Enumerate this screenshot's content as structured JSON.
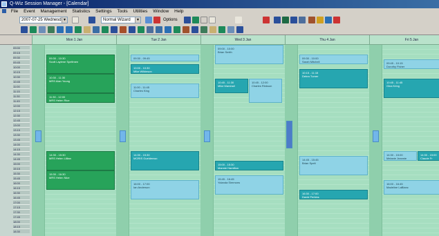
{
  "window": {
    "title": "Q-Wiz Session Manager - [Calendar]"
  },
  "menu": {
    "items": [
      "File",
      "Event",
      "Management",
      "Statistics",
      "Settings",
      "Tools",
      "Utilities",
      "Window",
      "Help"
    ]
  },
  "toolbar": {
    "date_value": "2007-07-25 Wednesday",
    "view_value": "Normal Wizard",
    "options_label": "Options"
  },
  "calendar": {
    "days": [
      {
        "label": "Mon 1 Jan"
      },
      {
        "label": "Tue 2 Jan"
      },
      {
        "label": "Wed 3 Jan"
      },
      {
        "label": "Thu 4 Jan"
      },
      {
        "label": "Fri 5 Jan"
      }
    ],
    "times": [
      "09:00",
      "09:15",
      "09:30",
      "09:45",
      "10:00",
      "10:15",
      "10:30",
      "10:45",
      "11:00",
      "11:15",
      "11:30",
      "11:45",
      "12:00",
      "12:15",
      "12:30",
      "12:45",
      "13:00",
      "13:15",
      "13:30",
      "13:45",
      "14:00",
      "14:15",
      "14:30",
      "14:45",
      "15:00",
      "15:15",
      "15:30",
      "15:45",
      "16:00",
      "16:15",
      "16:30",
      "16:45",
      "17:00",
      "17:15",
      "17:30",
      "17:45",
      "18:00",
      "18:15",
      "18:30"
    ],
    "appointments": [
      {
        "day": 0,
        "time": "09:30 - 10:30",
        "name": "Scott Laylene Speltmen",
        "color": "green"
      },
      {
        "day": 0,
        "time": "10:30 - 11:30",
        "name": "MRS Alan Young",
        "color": "green"
      },
      {
        "day": 0,
        "time": "11:30 - 12:00",
        "name": "MRS Helen Rice",
        "color": "green"
      },
      {
        "day": 0,
        "time": "14:30 - 15:30",
        "name": "MRS Helen Lillian",
        "color": "green"
      },
      {
        "day": 0,
        "time": "15:30 - 16:30",
        "name": "MRS Helen Nice",
        "color": "green"
      },
      {
        "day": 1,
        "time": "09:30 - 09:45",
        "name": "Daniel Morton",
        "color": "light"
      },
      {
        "day": 1,
        "time": "10:00 - 10:30",
        "name": "Mike Wilkinson",
        "color": "teal"
      },
      {
        "day": 1,
        "time": "11:00 - 11:45",
        "name": "Charles King",
        "color": "light"
      },
      {
        "day": 1,
        "time": "14:30 - 15:30",
        "name": "MORIS Gueldenwo",
        "color": "teal"
      },
      {
        "day": 1,
        "time": "16:00 - 17:00",
        "name": "Ian Anderson",
        "color": "light"
      },
      {
        "day": 2,
        "time": "09:00 - 10:00",
        "name": "Brian Smith",
        "color": "light"
      },
      {
        "day": 2,
        "time": "10:45 - 11:30",
        "name": "Mike Marshall",
        "color": "teal"
      },
      {
        "day": 2,
        "time": "10:45 - 12:00",
        "name": "Charles Rinkson",
        "color": "light"
      },
      {
        "day": 2,
        "time": "15:00 - 15:30",
        "name": "Mannie Hamilton",
        "color": "teal"
      },
      {
        "day": 2,
        "time": "15:45 - 16:45",
        "name": "Yolanda Simmons",
        "color": "light"
      },
      {
        "day": 3,
        "time": "09:30 - 10:00",
        "name": "Sarah Mitchell",
        "color": "light"
      },
      {
        "day": 3,
        "time": "10:15 - 11:15",
        "name": "Debra Turner",
        "color": "teal"
      },
      {
        "day": 3,
        "time": "14:45 - 15:45",
        "name": "Brian Spelt",
        "color": "light"
      },
      {
        "day": 3,
        "time": "16:30 - 17:00",
        "name": "David Perkins",
        "color": "teal"
      },
      {
        "day": 4,
        "time": "09:45 - 10:15",
        "name": "Dorothy Fisher",
        "color": "light"
      },
      {
        "day": 4,
        "time": "10:45 - 11:45",
        "name": "Gina Kring",
        "color": "teal"
      },
      {
        "day": 4,
        "time": "14:30 - 15:00",
        "name": "Melanie Jeannie",
        "color": "light"
      },
      {
        "day": 4,
        "time": "14:30 - 15:00",
        "name": "Claude Fr",
        "color": "teal"
      },
      {
        "day": 4,
        "time": "16:00 - 16:45",
        "name": "Madeline LaBlanc",
        "color": "light"
      }
    ]
  }
}
